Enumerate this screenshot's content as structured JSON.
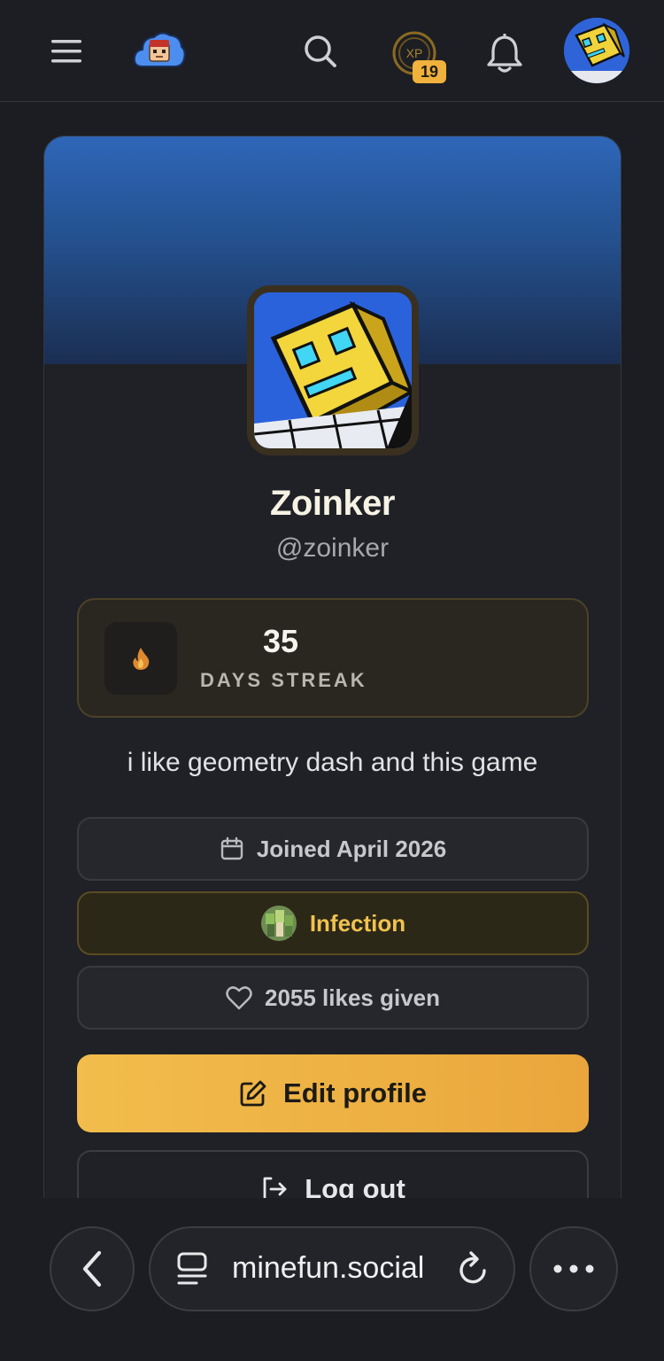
{
  "topbar": {
    "xp_count": "19",
    "xp_label": "XP",
    "icons": [
      "menu-icon",
      "cloud-logo",
      "search-icon",
      "xp-coin-icon",
      "bell-icon",
      "avatar"
    ]
  },
  "profile": {
    "display_name": "Zoinker",
    "handle": "@zoinker",
    "streak": {
      "count": "35",
      "label": "DAYS STREAK"
    },
    "bio": "i like geometry dash and this game",
    "joined": "Joined April 2026",
    "group": "Infection",
    "likes": "2055 likes given",
    "edit_label": "Edit profile",
    "logout_label": "Log out"
  },
  "browser": {
    "url": "minefun.social"
  },
  "colors": {
    "accent": "#f0b13d",
    "banner": "#2e66b8",
    "background": "#1b1d22"
  }
}
